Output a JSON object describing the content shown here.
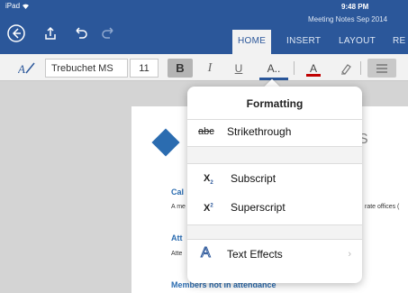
{
  "status": {
    "device": "iPad",
    "time": "9:48 PM",
    "doc_title": "Meeting Notes Sep 2014"
  },
  "tabs": [
    {
      "label": "HOME",
      "active": true
    },
    {
      "label": "INSERT",
      "active": false
    },
    {
      "label": "LAYOUT",
      "active": false
    },
    {
      "label": "RE",
      "active": false
    }
  ],
  "ribbon": {
    "font_name": "Trebuchet MS",
    "font_size": "11",
    "bold": "B",
    "italic": "I",
    "underline": "U",
    "more_format": "A..",
    "font_color": "A",
    "font_color_hex": "#c00000"
  },
  "document": {
    "heading_s": "S",
    "section1_heading": "Cal",
    "section1_text_left": "A me",
    "section1_text_right": "rate offices (",
    "section2_heading": "Att",
    "section2_text": "Atte",
    "section3_heading": "Members not in attendance"
  },
  "popover": {
    "title": "Formatting",
    "strikethrough_icon": "abc",
    "strikethrough": "Strikethrough",
    "subscript_icon_base": "X",
    "subscript_icon_mark": "2",
    "subscript": "Subscript",
    "superscript_icon_base": "X",
    "superscript_icon_mark": "2",
    "superscript": "Superscript",
    "text_effects_icon": "A",
    "text_effects": "Text Effects"
  },
  "colors": {
    "accent": "#2b579a",
    "doc_blue": "#2b6cb0"
  }
}
